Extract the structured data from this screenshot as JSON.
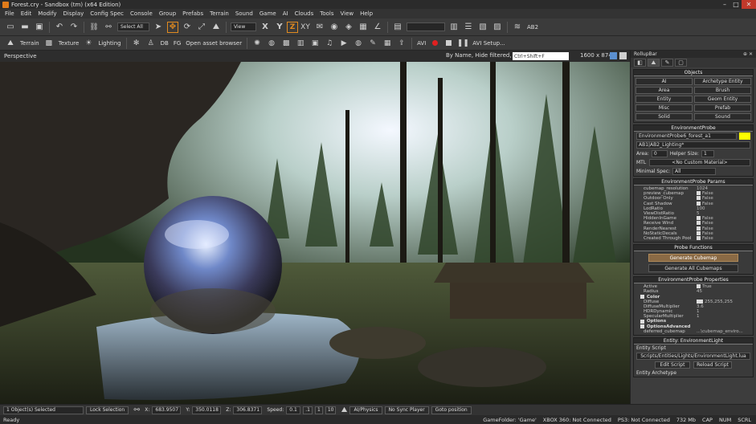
{
  "window": {
    "title": "Forest.cry - Sandbox (tm) (x64 Edition)"
  },
  "menu": [
    "File",
    "Edit",
    "Modify",
    "Display",
    "Config Spec",
    "Console",
    "Group",
    "Prefabs",
    "Terrain",
    "Sound",
    "Game",
    "AI",
    "Clouds",
    "Tools",
    "View",
    "Help"
  ],
  "toolbar": {
    "select_all": "Select All",
    "view_select": "View",
    "axis_x": "X",
    "axis_y": "Y",
    "axis_z": "Z",
    "axis_xy": "XY",
    "ab2_label": "AB2",
    "terrain": "Terrain",
    "texture": "Texture",
    "lighting": "Lighting",
    "db": "DB",
    "fg": "FG",
    "open_asset_browser": "Open asset browser",
    "avi": "AVI",
    "avi_setup": "AVI Setup..."
  },
  "viewport": {
    "title": "Perspective",
    "filter_text": "By Name, Hide filtered, AND",
    "search_placeholder": "Ctrl+Shift+F",
    "resolution": "1600 x 874"
  },
  "rollup": {
    "title": "RollupBar",
    "objects": {
      "header": "Objects",
      "buttons": [
        "AI",
        "Archetype Entity",
        "Area",
        "Brush",
        "Entity",
        "Geom Entity",
        "Misc",
        "Prefab",
        "Solid",
        "Sound"
      ]
    },
    "env_probe": {
      "header": "EnvironmentProbe",
      "name_value": "EnvironmentProbe6_forest_a1",
      "layer": "AB1|AB2_Lighting*",
      "area_label": "Area:",
      "area_value": "0",
      "helper_label": "Helper Size:",
      "helper_value": "1",
      "mtl_label": "MTL",
      "mtl_value": "<No Custom Material>",
      "minspec_label": "Minimal Spec:",
      "minspec_value": "All"
    },
    "env_params": {
      "header": "EnvironmentProbe Params",
      "rows": [
        {
          "name": "cubemap_resolution",
          "value": "1024",
          "check": false
        },
        {
          "name": "preview_cubemap",
          "value": "False",
          "check": true
        },
        {
          "name": "Outdoor Only",
          "value": "False",
          "check": true
        },
        {
          "name": "Cast Shadow",
          "value": "False",
          "check": true
        },
        {
          "name": "LodRatio",
          "value": "100",
          "check": false
        },
        {
          "name": "ViewDistRatio",
          "value": "5",
          "check": false
        },
        {
          "name": "HiddenInGame",
          "value": "False",
          "check": true
        },
        {
          "name": "Receive Wind",
          "value": "False",
          "check": true
        },
        {
          "name": "RenderNearest",
          "value": "False",
          "check": true
        },
        {
          "name": "NoStaticDecals",
          "value": "False",
          "check": true
        },
        {
          "name": "Created Through Pool",
          "value": "False",
          "check": true
        }
      ]
    },
    "probe_functions": {
      "header": "Probe Functions",
      "generate_cubemap": "Generate Cubemap",
      "generate_all": "Generate All Cubemaps"
    },
    "env_props": {
      "header": "EnvironmentProbe Properties",
      "rows": [
        {
          "name": "Active",
          "value": "True",
          "check": true
        },
        {
          "name": "Radius",
          "value": "45",
          "check": false
        }
      ],
      "color_group": "Color",
      "color_rows": [
        {
          "name": "Diffuse",
          "value": "255,255,255"
        },
        {
          "name": "DiffuseMultiplier",
          "value": "3.6"
        },
        {
          "name": "HDRDynamic",
          "value": "1"
        },
        {
          "name": "SpecularMultiplier",
          "value": "1"
        }
      ],
      "options_group": "Options",
      "options_adv_group": "OptionsAdvanced",
      "deferred_name": "deferred_cubemap",
      "deferred_value": "...\\cubemap_enviro..."
    },
    "entity_light": {
      "header": "Entity: EnvironmentLight",
      "script_label": "Entity Script",
      "script_path": "Scripts/Entities/Lights/EnvironmentLight.lua",
      "edit_script": "Edit Script",
      "reload_script": "Reload Script",
      "archetype_label": "Entity Archetype"
    }
  },
  "status": {
    "selected": "1 Object(s) Selected",
    "lock_selection": "Lock Selection",
    "x_label": "X:",
    "x_value": "683.9507",
    "y_label": "Y:",
    "y_value": "350.0118",
    "z_label": "Z:",
    "z_value": "306.8371",
    "speed_label": "Speed:",
    "speed_value": "0.1",
    "speed_opts": [
      ".1",
      "1",
      "10"
    ],
    "ai_physics": "AI/Physics",
    "no_sync_player": "No Sync Player",
    "goto_position": "Goto position"
  },
  "bottom": {
    "ready": "Ready",
    "game_folder": "GameFolder: 'Game'",
    "xbox": "XBOX 360: Not Connected",
    "ps3": "PS3: Not Connected",
    "memory": "732 Mb",
    "cap": "CAP",
    "num": "NUM",
    "scrl": "SCRL"
  },
  "colors": {
    "accent": "#e08a20",
    "record": "#e02020",
    "probe_color": "#ffff00"
  }
}
